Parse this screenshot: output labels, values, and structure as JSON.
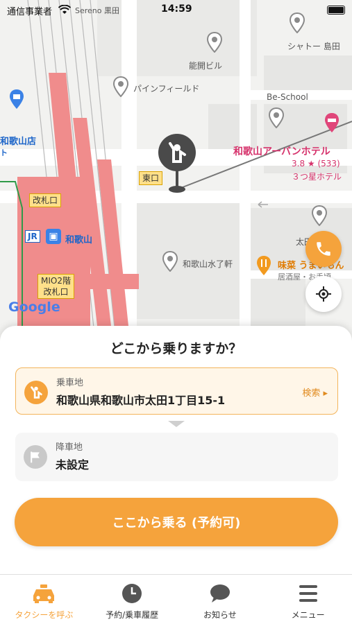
{
  "status_bar": {
    "carrier": "通信事業者",
    "wifi_name": "Sereno 黒田",
    "time": "14:59"
  },
  "map": {
    "labels": {
      "chateau": "シャトー 島田",
      "noukai": "能開ビル",
      "pinefield": "パインフィールド",
      "beschool": "Be-School",
      "hotel_name": "和歌山アーバンホテル",
      "hotel_rating": "3.8 ★ (533)",
      "hotel_class": "３つ星ホテル",
      "store_left": "和歌山店",
      "store_left_sub": "ト",
      "east_exit": "東口",
      "ticket_gate": "改札口",
      "jr_mark": "JR",
      "station_name": "和歌山",
      "mio": "MIO2階\n改札口",
      "mizuryo": "和歌山水了軒",
      "ajina": "味菜 うまいもん",
      "ajina_sub": "居酒屋・お手頃",
      "ota": "太田",
      "google": "Google"
    }
  },
  "sheet": {
    "title": "どこから乗りますか？",
    "pickup": {
      "label": "乗車地",
      "value": "和歌山県和歌山市太田1丁目15-1",
      "search": "検索 ▸"
    },
    "dropoff": {
      "label": "降車地",
      "value": "未設定"
    },
    "ride_button": "ここから乗る (予約可)"
  },
  "tabs": [
    {
      "label": "タクシーを呼ぶ",
      "icon": "taxi-icon",
      "active": true
    },
    {
      "label": "予約/乗車履歴",
      "icon": "clock-icon",
      "active": false
    },
    {
      "label": "お知らせ",
      "icon": "chat-bubble-icon",
      "active": false
    },
    {
      "label": "メニュー",
      "icon": "menu-icon",
      "active": false
    }
  ],
  "colors": {
    "accent": "#f5a33c",
    "accent_text": "#e08a1e",
    "station": "#f08c8c",
    "hotel": "#d6336c"
  }
}
